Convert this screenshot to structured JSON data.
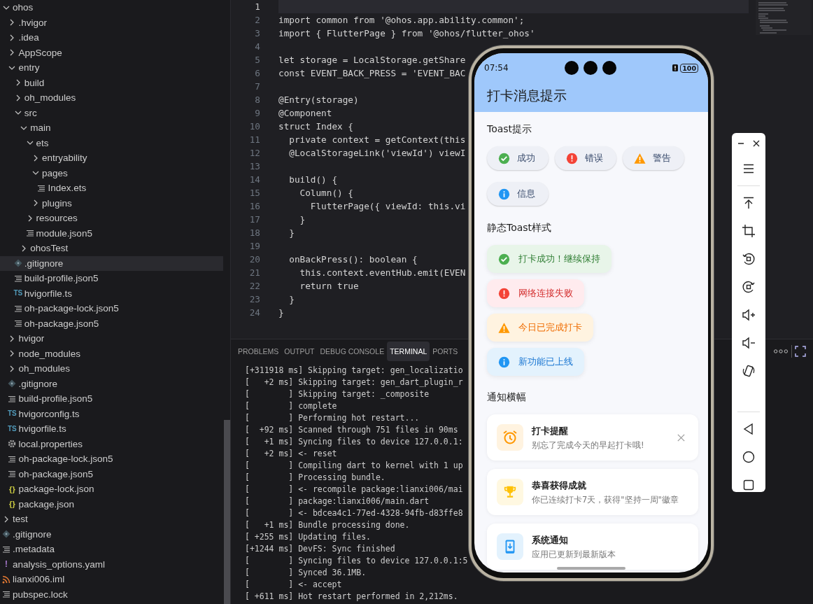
{
  "explorer": {
    "items": [
      {
        "name": "ohos",
        "kind": "folder",
        "expanded": true,
        "selected": false,
        "children": [
          {
            "name": ".hvigor",
            "kind": "folder",
            "expanded": false,
            "selected": false
          },
          {
            "name": ".idea",
            "kind": "folder",
            "expanded": false,
            "selected": false
          },
          {
            "name": "AppScope",
            "kind": "folder",
            "expanded": false,
            "selected": false
          },
          {
            "name": "entry",
            "kind": "folder",
            "expanded": true,
            "selected": false,
            "children": [
              {
                "name": "build",
                "kind": "folder",
                "expanded": false,
                "selected": false
              },
              {
                "name": "oh_modules",
                "kind": "folder",
                "expanded": false,
                "selected": false
              },
              {
                "name": "src",
                "kind": "folder",
                "expanded": true,
                "selected": false,
                "children": [
                  {
                    "name": "main",
                    "kind": "folder",
                    "expanded": true,
                    "selected": false,
                    "children": [
                      {
                        "name": "ets",
                        "kind": "folder",
                        "expanded": true,
                        "selected": false,
                        "children": [
                          {
                            "name": "entryability",
                            "kind": "folder",
                            "expanded": false,
                            "selected": false
                          },
                          {
                            "name": "pages",
                            "kind": "folder",
                            "expanded": true,
                            "selected": false,
                            "children": [
                              {
                                "name": "Index.ets",
                                "kind": "lines",
                                "selected": false
                              }
                            ]
                          },
                          {
                            "name": "plugins",
                            "kind": "folder",
                            "expanded": false,
                            "selected": false
                          }
                        ]
                      },
                      {
                        "name": "resources",
                        "kind": "folder",
                        "expanded": false,
                        "selected": false
                      },
                      {
                        "name": "module.json5",
                        "kind": "lines",
                        "selected": false
                      }
                    ]
                  },
                  {
                    "name": "ohosTest",
                    "kind": "folder",
                    "expanded": false,
                    "selected": false
                  }
                ]
              },
              {
                "name": ".gitignore",
                "kind": "git",
                "selected": true
              },
              {
                "name": "build-profile.json5",
                "kind": "lines",
                "selected": false
              },
              {
                "name": "hvigorfile.ts",
                "kind": "ts",
                "icon_text": "TS",
                "selected": false
              },
              {
                "name": "oh-package-lock.json5",
                "kind": "lines",
                "selected": false
              },
              {
                "name": "oh-package.json5",
                "kind": "lines",
                "selected": false
              }
            ]
          },
          {
            "name": "hvigor",
            "kind": "folder",
            "expanded": false,
            "selected": false
          },
          {
            "name": "node_modules",
            "kind": "folder",
            "expanded": false,
            "selected": false
          },
          {
            "name": "oh_modules",
            "kind": "folder",
            "expanded": false,
            "selected": false
          },
          {
            "name": ".gitignore",
            "kind": "git",
            "selected": false
          },
          {
            "name": "build-profile.json5",
            "kind": "lines",
            "selected": false
          },
          {
            "name": "hvigorconfig.ts",
            "kind": "ts",
            "icon_text": "TS",
            "selected": false
          },
          {
            "name": "hvigorfile.ts",
            "kind": "ts",
            "icon_text": "TS",
            "selected": false
          },
          {
            "name": "local.properties",
            "kind": "gear",
            "selected": false
          },
          {
            "name": "oh-package-lock.json5",
            "kind": "lines",
            "selected": false
          },
          {
            "name": "oh-package.json5",
            "kind": "lines",
            "selected": false
          },
          {
            "name": "package-lock.json",
            "kind": "json",
            "icon_text": "{}",
            "selected": false
          },
          {
            "name": "package.json",
            "kind": "json",
            "icon_text": "{}",
            "selected": false
          }
        ]
      },
      {
        "name": "test",
        "kind": "folder",
        "expanded": false,
        "selected": false
      },
      {
        "name": ".gitignore",
        "kind": "git",
        "selected": false
      },
      {
        "name": ".metadata",
        "kind": "lines",
        "selected": false
      },
      {
        "name": "analysis_options.yaml",
        "kind": "yaml",
        "icon_text": "!",
        "selected": false
      },
      {
        "name": "lianxi006.iml",
        "kind": "rss",
        "selected": false
      },
      {
        "name": "pubspec.lock",
        "kind": "lines",
        "selected": false
      }
    ]
  },
  "editor": {
    "lines": [
      {
        "number": "1",
        "current": true
      },
      {
        "number": "2",
        "text": "import common from '@ohos.app.ability.common';",
        "current": false
      },
      {
        "number": "3",
        "text": "import { FlutterPage } from '@ohos/flutter_ohos'",
        "current": false
      },
      {
        "number": "4",
        "current": false
      },
      {
        "number": "5",
        "text": "let storage = LocalStorage.getShare",
        "current": false
      },
      {
        "number": "6",
        "text": "const EVENT_BACK_PRESS = 'EVENT_BAC",
        "current": false
      },
      {
        "number": "7",
        "current": false
      },
      {
        "number": "8",
        "text": "@Entry(storage)",
        "current": false
      },
      {
        "number": "9",
        "text": "@Component",
        "current": false
      },
      {
        "number": "10",
        "text": "struct Index {",
        "current": false
      },
      {
        "number": "11",
        "text": "  private context = getContext(this",
        "current": false
      },
      {
        "number": "12",
        "text": "  @LocalStorageLink('viewId') viewI",
        "current": false
      },
      {
        "number": "13",
        "current": false
      },
      {
        "number": "14",
        "text": "  build() {",
        "current": false
      },
      {
        "number": "15",
        "text": "    Column() {",
        "current": false
      },
      {
        "number": "16",
        "text": "      FlutterPage({ viewId: this.vi",
        "current": false
      },
      {
        "number": "17",
        "text": "    }",
        "current": false
      },
      {
        "number": "18",
        "text": "  }",
        "current": false
      },
      {
        "number": "19",
        "current": false
      },
      {
        "number": "20",
        "text": "  onBackPress(): boolean {",
        "current": false
      },
      {
        "number": "21",
        "text": "    this.context.eventHub.emit(EVEN",
        "current": false
      },
      {
        "number": "22",
        "text": "    return true",
        "current": false
      },
      {
        "number": "23",
        "text": "  }",
        "current": false
      },
      {
        "number": "24",
        "text": "}",
        "current": false
      }
    ]
  },
  "panel": {
    "tabs": [
      {
        "label": "PROBLEMS",
        "selected": false
      },
      {
        "label": "OUTPUT",
        "selected": false
      },
      {
        "label": "DEBUG CONSOLE",
        "selected": false
      },
      {
        "label": "TERMINAL",
        "selected": true
      },
      {
        "label": "PORTS",
        "selected": false
      }
    ],
    "terminal_lines": [
      "[+311918 ms] Skipping target: gen_localizatio",
      "[   +2 ms] Skipping target: gen_dart_plugin_r",
      "[        ] Skipping target: _composite",
      "[        ] complete",
      "[        ] Performing hot restart...",
      "[  +92 ms] Scanned through 751 files in 90ms",
      "[   +1 ms] Syncing files to device 127.0.0.1:",
      "[   +2 ms] <- reset",
      "[        ] Compiling dart to kernel with 1 up",
      "[        ] Processing bundle.",
      "[        ] <- recompile package:lianxi006/mai",
      "[        ] package:lianxi006/main.dart",
      "[        ] <- bdcea4c1-77ed-4328-94fb-d83ffe8",
      "[   +1 ms] Bundle processing done.",
      "[ +255 ms] Updating files.",
      "[+1244 ms] DevFS: Sync finished",
      "[        ] Syncing files to device 127.0.0.1:5",
      "[        ] Synced 36.1MB.",
      "[        ] <- accept",
      "[ +611 ms] Hot restart performed in 2,212ms."
    ]
  },
  "phone": {
    "status_bar": {
      "time": "07:54",
      "battery": "100"
    },
    "app_bar": {
      "title": "打卡消息提示"
    },
    "toast_section": {
      "title": "Toast提示",
      "buttons": [
        {
          "kind": "success",
          "label": "成功"
        },
        {
          "kind": "error",
          "label": "错误"
        },
        {
          "kind": "warning",
          "label": "警告"
        },
        {
          "kind": "info",
          "label": "信息"
        }
      ]
    },
    "static_section": {
      "title": "静态Toast样式",
      "toasts": [
        {
          "kind": "success",
          "text": "打卡成功！继续保持"
        },
        {
          "kind": "error",
          "text": "网络连接失败"
        },
        {
          "kind": "warning",
          "text": "今日已完成打卡"
        },
        {
          "kind": "info",
          "text": "新功能已上线"
        }
      ]
    },
    "banner_section": {
      "title": "通知横幅",
      "banners": [
        {
          "kind": "alarm",
          "title": "打卡提醒",
          "subtitle": "别忘了完成今天的早起打卡哦!",
          "closable": true
        },
        {
          "kind": "trophy",
          "title": "恭喜获得成就",
          "subtitle": "你已连续打卡7天，获得\"坚持一周\"徽章",
          "closable": false
        },
        {
          "kind": "update",
          "title": "系统通知",
          "subtitle": "应用已更新到最新版本",
          "closable": false
        }
      ]
    }
  }
}
